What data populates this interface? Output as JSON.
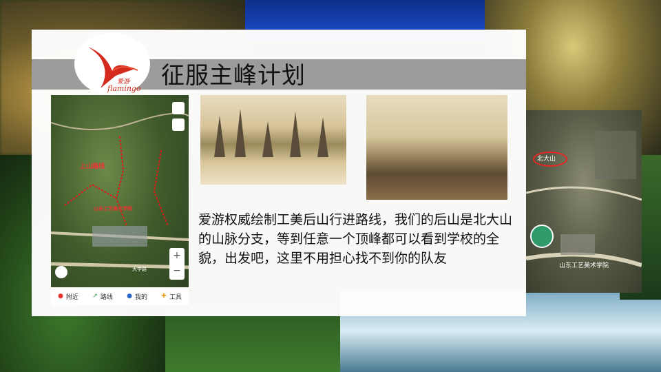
{
  "slide": {
    "title": "征服主峰计划",
    "description": "爱游权威绘制工美后山行进路线，我们的后山是北大山的山脉分支，等到任意一个顶峰都可以看到学校的全貌，出发吧，这里不用担心找不到你的队友"
  },
  "logo": {
    "text_cn": "爱游",
    "text_en": "flamingo",
    "color": "#d42a1e"
  },
  "map": {
    "route_label": "上山路线",
    "campus_label": "山东工艺美术学院",
    "road_label": "大学路",
    "zoom_in": "+",
    "zoom_out": "−",
    "toolbar": [
      {
        "icon": "location-pin-icon",
        "label": "附近"
      },
      {
        "icon": "route-icon",
        "label": "路线"
      },
      {
        "icon": "person-icon",
        "label": "我的"
      },
      {
        "icon": "tools-icon",
        "label": "工具"
      }
    ]
  },
  "satellite": {
    "mountain_label": "北大山",
    "campus_label": "山东工艺美术学院"
  }
}
